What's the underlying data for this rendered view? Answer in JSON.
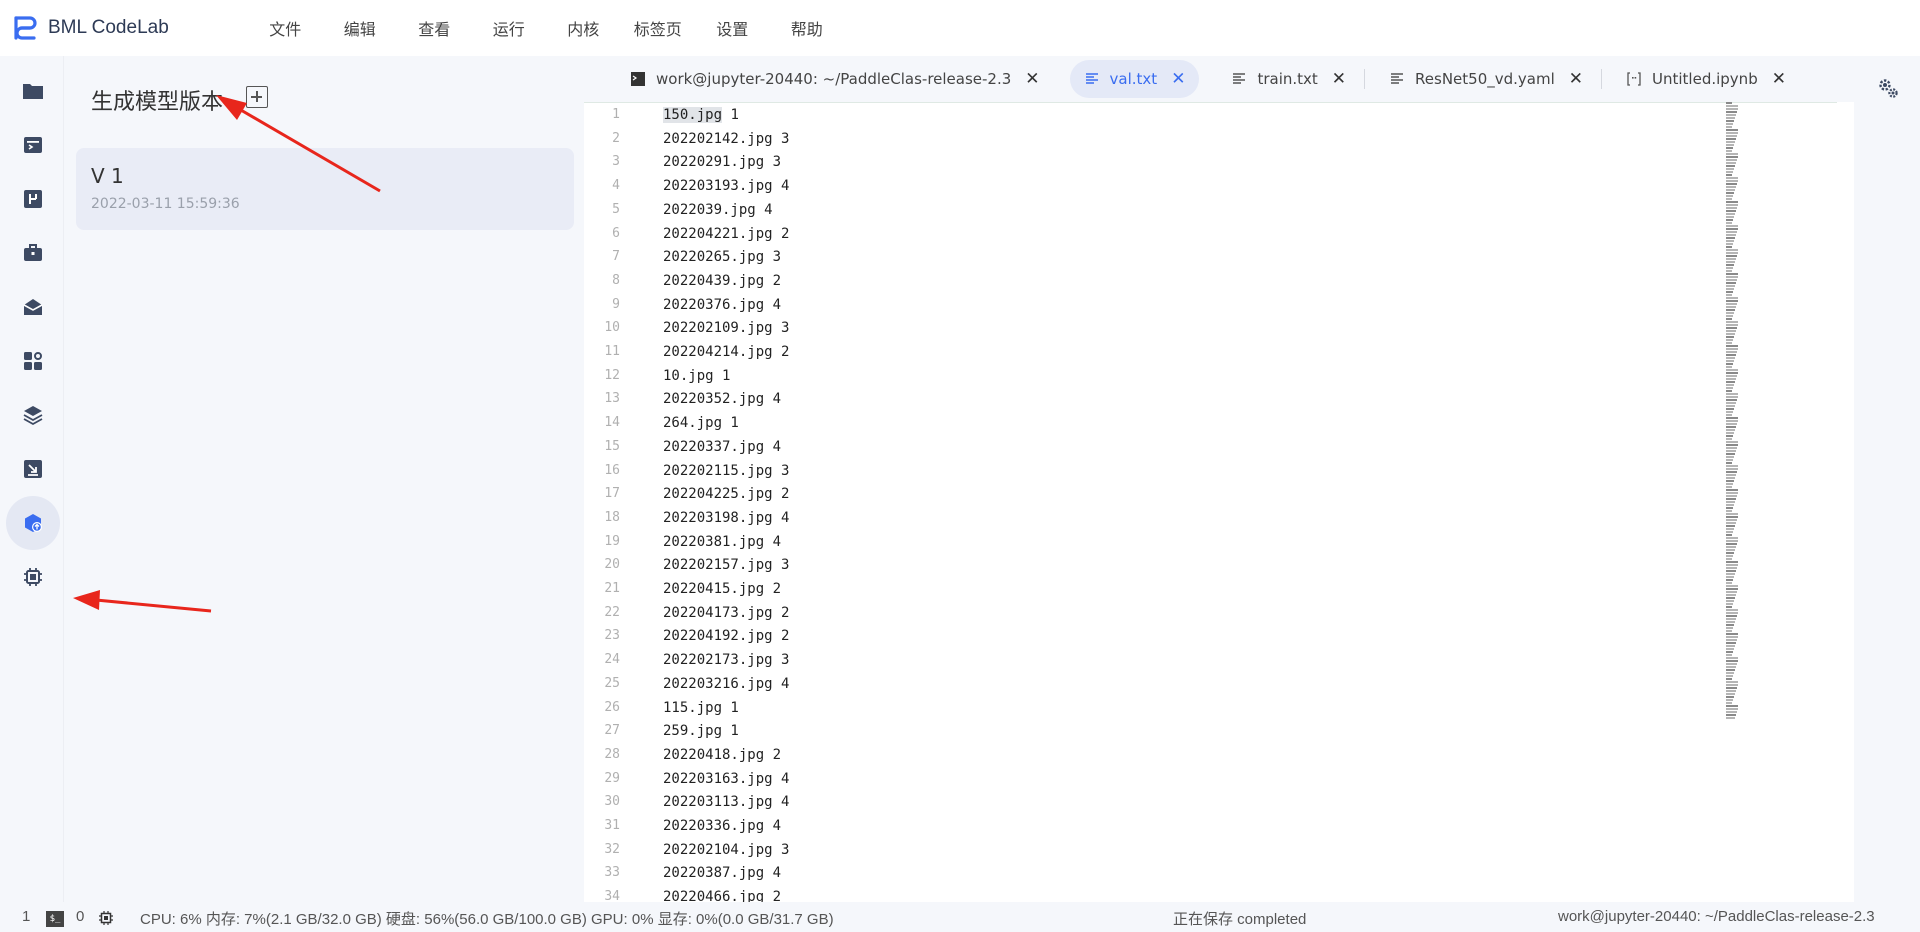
{
  "app": {
    "title": "BML CodeLab",
    "brand_color": "#3a6df0"
  },
  "menu": [
    "文件",
    "编辑",
    "查看",
    "运行",
    "内核",
    "标签页",
    "设置",
    "帮助"
  ],
  "sidebar_icons": [
    {
      "name": "folder-icon",
      "active": false
    },
    {
      "name": "running-icon",
      "active": false
    },
    {
      "name": "dataset-icon",
      "active": false
    },
    {
      "name": "toolbox-icon",
      "active": false
    },
    {
      "name": "open-box-icon",
      "active": false
    },
    {
      "name": "extensions-icon",
      "active": false
    },
    {
      "name": "layers-icon",
      "active": false
    },
    {
      "name": "download-icon",
      "active": false
    },
    {
      "name": "model-version-icon",
      "active": true
    },
    {
      "name": "chip-icon",
      "active": false
    }
  ],
  "panel": {
    "title": "生成模型版本",
    "versions": [
      {
        "name": "V 1",
        "date": "2022-03-11 15:59:36"
      }
    ]
  },
  "tabs": [
    {
      "label": "work@jupyter-20440: ~/PaddleClas-release-2.3",
      "icon": "terminal-icon",
      "active": false
    },
    {
      "label": "val.txt",
      "icon": "text-file-icon",
      "active": true
    },
    {
      "label": "train.txt",
      "icon": "text-file-icon",
      "active": false
    },
    {
      "label": "ResNet50_vd.yaml",
      "icon": "text-file-icon",
      "active": false
    },
    {
      "label": "Untitled.ipynb",
      "icon": "notebook-icon",
      "active": false
    }
  ],
  "editor": {
    "lines": [
      "150.jpg 1",
      "202202142.jpg 3",
      "20220291.jpg 3",
      "202203193.jpg 4",
      "2022039.jpg 4",
      "202204221.jpg 2",
      "20220265.jpg 3",
      "20220439.jpg 2",
      "20220376.jpg 4",
      "202202109.jpg 3",
      "202204214.jpg 2",
      "10.jpg 1",
      "20220352.jpg 4",
      "264.jpg 1",
      "20220337.jpg 4",
      "202202115.jpg 3",
      "202204225.jpg 2",
      "202203198.jpg 4",
      "20220381.jpg 4",
      "202202157.jpg 3",
      "20220415.jpg 2",
      "202204173.jpg 2",
      "202204192.jpg 2",
      "202202173.jpg 3",
      "202203216.jpg 4",
      "115.jpg 1",
      "259.jpg 1",
      "20220418.jpg 2",
      "202203163.jpg 4",
      "202203113.jpg 4",
      "20220336.jpg 4",
      "202202104.jpg 3",
      "20220387.jpg 4",
      "20220466.jpg 2"
    ],
    "selected_text": "150.jpg"
  },
  "status": {
    "left_count": "1",
    "term_label": "$_",
    "kernel_count": "0",
    "resources": "CPU:  6% 内存:  7%(2.1 GB/32.0 GB) 硬盘:  56%(56.0 GB/100.0 GB)  GPU:  0%  显存:  0%(0.0 GB/31.7 GB)",
    "save_state": "正在保存 completed",
    "path": "work@jupyter-20440: ~/PaddleClas-release-2.3"
  },
  "annotation_color": "#e8261c"
}
